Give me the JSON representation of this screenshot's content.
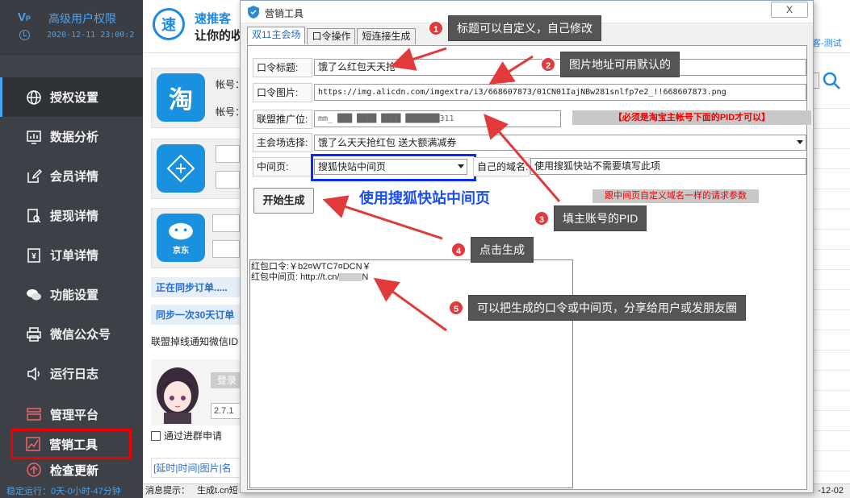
{
  "sidebar": {
    "title": "高级用户权限",
    "datetime": "2020-12-11 23:00:2",
    "items": [
      {
        "label": "授权设置",
        "icon": "globe-icon"
      },
      {
        "label": "数据分析",
        "icon": "chart-icon"
      },
      {
        "label": "会员详情",
        "icon": "edit-icon"
      },
      {
        "label": "提现详情",
        "icon": "search-doc-icon"
      },
      {
        "label": "订单详情",
        "icon": "yen-doc-icon"
      },
      {
        "label": "功能设置",
        "icon": "chat-icon"
      },
      {
        "label": "微信公众号",
        "icon": "printer-icon"
      },
      {
        "label": "运行日志",
        "icon": "speaker-icon"
      },
      {
        "label": "管理平台",
        "icon": "grid-icon"
      }
    ],
    "marketing": {
      "label": "营销工具",
      "icon": "marketing-chart-icon"
    },
    "check_update": {
      "label": "检查更新",
      "icon": "upload-icon"
    },
    "running": "稳定运行：0天-0小时-47分钟"
  },
  "main": {
    "brand_logo": "速",
    "brand_name": "速推客",
    "slogan": "让你的收",
    "right_link": "客-测试",
    "account_label": "帐号：",
    "taobao_icon": "淘",
    "jd_label": "京东",
    "syncing": "正在同步订单.....",
    "sync30": "同步一次30天订单",
    "alliance": "联盟掉线通知微信ID",
    "login": "登录",
    "version": "2.7.1",
    "chk1": "通过进群申请",
    "bottom_links": "[延时|时间|图片|名",
    "status_label": "消息提示：",
    "status_text": "生成t.cn短",
    "status_date": "-12-02"
  },
  "dialog": {
    "title": "营销工具",
    "close": "X",
    "tabs": [
      "双11主会场",
      "口令操作",
      "短连接生成"
    ],
    "fields": {
      "title_label": "口令标题:",
      "title_value": "饿了么红包天天抢",
      "image_label": "口令图片:",
      "image_value": "https://img.alicdn.com/imgextra/i3/668607873/01CN01IajNBw281snlfp7e2_!!668607873.png",
      "pid_label": "联盟推广位:",
      "pid_value": "mm_ ███ ████ ████ ███████311",
      "pid_note": "【必须是淘宝主帐号下面的PID才可以】",
      "venue_label": "主会场选择:",
      "venue_value": "饿了么天天抢红包 送大额满减券",
      "mid_label": "中间页:",
      "mid_value": "搜狐快站中间页",
      "domain_label": "自己的域名:",
      "domain_value": "使用搜狐快站不需要填写此项",
      "domain_note": "跟中间页自定义域名一样的请求参数",
      "sohu_note": "使用搜狐快站中间页",
      "generate": "开始生成"
    },
    "output": {
      "line1": "红包口令:￥b2¤WTC7¤DCN￥",
      "line2_prefix": "红包中间页: http://t.cn/",
      "line2_suffix": "N"
    }
  },
  "annotations": [
    {
      "num": "1",
      "text": "标题可以自定义，自己修改"
    },
    {
      "num": "2",
      "text": "图片地址可用默认的"
    },
    {
      "num": "3",
      "text": "填主账号的PID"
    },
    {
      "num": "4",
      "text": "点击生成"
    },
    {
      "num": "5",
      "text": "可以把生成的口令或中间页，分享给用户或发朋友圈"
    }
  ],
  "colors": {
    "accent": "#1e88e5",
    "sidebar_bg": "#3d4046",
    "annotation_red": "#e23a3a",
    "highlight_blue": "#0a2bff"
  }
}
